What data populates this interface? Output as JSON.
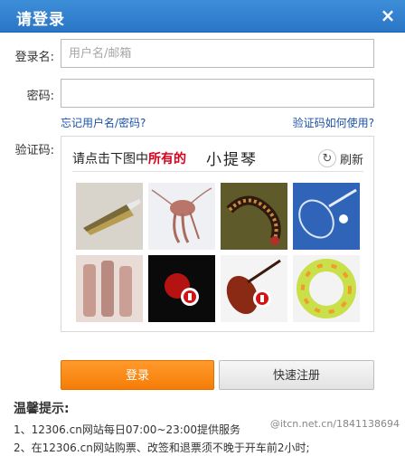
{
  "dialog": {
    "title": "请登录",
    "close_label": "×"
  },
  "form": {
    "username_label": "登录名:",
    "username_placeholder": "用户名/邮箱",
    "password_label": "密码:",
    "password_value": "",
    "forgot_link": "忘记用户名/密码?",
    "captcha_help_link": "验证码如何使用?",
    "captcha_label": "验证码:"
  },
  "captcha": {
    "prompt_prefix": "请点击下图中",
    "prompt_highlight": "所有的",
    "target_word": "小提琴",
    "refresh_label": "刷新",
    "tiles": [
      {
        "subject": "tweezers"
      },
      {
        "subject": "shrimp"
      },
      {
        "subject": "centipede"
      },
      {
        "subject": "badminton-racket"
      },
      {
        "subject": "dried-fish"
      },
      {
        "subject": "red-light-logo"
      },
      {
        "subject": "violin"
      },
      {
        "subject": "swim-ring"
      }
    ]
  },
  "buttons": {
    "login": "登录",
    "quick_register": "快速注册"
  },
  "tips": {
    "title": "温馨提示:",
    "items": [
      "1、12306.cn网站每日07:00~23:00提供服务",
      "2、在12306.cn网站购票、改签和退票须不晚于开车前2小时;"
    ]
  },
  "watermark": {
    "text": "@itcn.net.cn/1841138694"
  },
  "colors": {
    "titlebar": "#2f7fd0",
    "link": "#1a52a8",
    "highlight": "#d9001b",
    "login_button": "#f57d06"
  }
}
